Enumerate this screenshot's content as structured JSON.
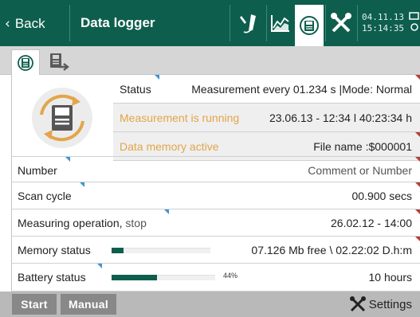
{
  "header": {
    "back_label": "Back",
    "title": "Data logger",
    "date": "04.11.13",
    "time": "15:14:35",
    "icons": [
      "probe-icon",
      "chart-icon",
      "data-logger-icon",
      "tools-icon",
      "battery-icon"
    ]
  },
  "status": {
    "status_label": "Status",
    "status_value": "Measurement every  01.234 s |Mode: Normal",
    "running_label": "Measurement is running",
    "running_value": "23.06.13 - 12:34 l 40:23:34 h",
    "memory_label": "Data memory active",
    "file_label": "File name :$000001"
  },
  "rows": {
    "number_label": "Number",
    "number_value": "Comment or Number",
    "scan_label": "Scan cycle",
    "scan_value": "00.900 secs",
    "operation_label": "Measuring operation,",
    "operation_suffix": "stop",
    "operation_value": "26.02.12 - 14:00",
    "memory_label": "Memory status",
    "memory_value": "07.126 Mb free \\ 02.22:02 D.h:m",
    "memory_fill": 0.12,
    "battery_label": "Battery status",
    "battery_percent_text": "44%",
    "battery_fill": 0.44,
    "battery_value": "10 hours"
  },
  "footer": {
    "start_label": "Start",
    "manual_label": "Manual",
    "settings_label": "Settings"
  },
  "colors": {
    "header": "#0d5e4d",
    "accent_orange": "#e3a54a",
    "marker_blue": "#3a96d2",
    "marker_red": "#b04040"
  }
}
